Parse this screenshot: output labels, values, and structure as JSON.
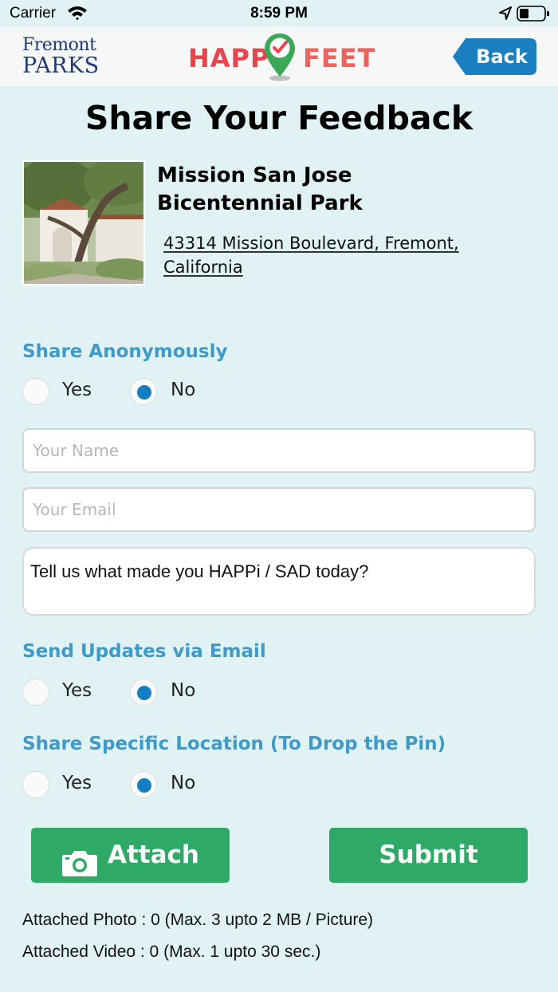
{
  "status_bar": {
    "carrier": "Carrier",
    "time": "8:59 PM"
  },
  "header": {
    "left_logo_line1": "Fremont",
    "left_logo_line2": "PARKS",
    "app_logo_word1": "HAPPi",
    "app_logo_word2": "FEET",
    "back_label": "Back"
  },
  "page": {
    "title": "Share Your Feedback"
  },
  "park": {
    "name_line1": "Mission San Jose",
    "name_line2": "Bicentennial Park",
    "address_line1": "43314 Mission Boulevard, Fremont,",
    "address_line2": "California"
  },
  "share_anonymously": {
    "label": "Share Anonymously",
    "yes_label": "Yes",
    "no_label": "No",
    "selected": "No"
  },
  "form": {
    "name_placeholder": "Your Name",
    "email_placeholder": "Your Email",
    "feedback_value": "Tell us what made you HAPPi / SAD today?"
  },
  "send_updates": {
    "label": "Send Updates via Email",
    "yes_label": "Yes",
    "no_label": "No",
    "selected": "No"
  },
  "share_location": {
    "label": "Share Specific Location (To Drop the Pin)",
    "yes_label": "Yes",
    "no_label": "No",
    "selected": "No"
  },
  "actions": {
    "attach_label": "Attach",
    "submit_label": "Submit"
  },
  "attachments": {
    "photo_text": "Attached Photo : 0 (Max. 3 upto 2 MB / Picture)",
    "video_text": "Attached Video : 0 (Max. 1 upto 30 sec.)"
  },
  "colors": {
    "background": "#e1f2f5",
    "accent_blue": "#3d9ac9",
    "radio_selected": "#137ec0",
    "button_green": "#2eaa66",
    "back_button": "#1a7fc1",
    "logo_red": "#e8454f",
    "pin_green": "#3aa856"
  },
  "icons": [
    "wifi-icon",
    "location-arrow-icon",
    "battery-icon",
    "map-pin-check-icon",
    "camera-icon"
  ]
}
